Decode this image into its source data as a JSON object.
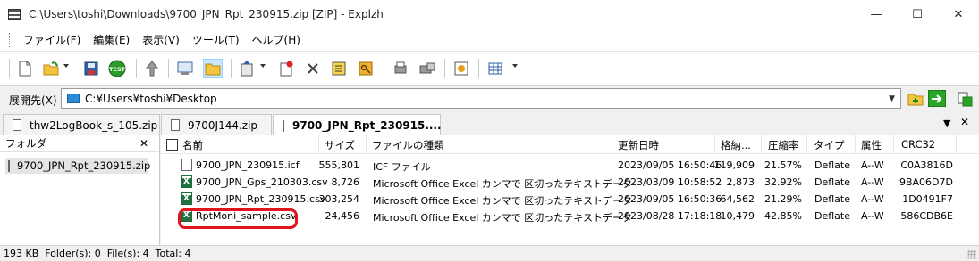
{
  "window": {
    "title": "C:\\Users\\toshi\\Downloads\\9700_JPN_Rpt_230915.zip [ZIP] - Explzh",
    "minimize": "—",
    "maximize": "☐",
    "close": "✕"
  },
  "menu": {
    "items": [
      "ファイル(F)",
      "編集(E)",
      "表示(V)",
      "ツール(T)",
      "ヘルプ(H)"
    ]
  },
  "toolbar": {
    "icons": [
      "new-archive-icon",
      "open-icon",
      "save-icon",
      "test-icon",
      "extract-icon",
      "view-icon",
      "open-folder-icon",
      "add-icon",
      "delete-marked-icon",
      "delete-icon",
      "properties-icon",
      "key-icon",
      "print-icon",
      "print-preview-icon",
      "info-icon",
      "view-mode-icon"
    ],
    "test_label": "TEST"
  },
  "address": {
    "label": "展開先(X)",
    "path": "C:¥Users¥toshi¥Desktop"
  },
  "tabs": [
    {
      "label": "thw2LogBook_s_105.zip"
    },
    {
      "label": "9700J144.zip"
    },
    {
      "label": "9700_JPN_Rpt_230915...."
    }
  ],
  "folder_pane": {
    "title": "フォルダ",
    "close": "✕",
    "item": "9700_JPN_Rpt_230915.zip"
  },
  "file_list": {
    "columns": [
      "名前",
      "サイズ",
      "ファイルの種類",
      "更新日時",
      "格納...",
      "圧縮率",
      "タイプ",
      "属性",
      "CRC32"
    ],
    "rows": [
      {
        "name": "9700_JPN_230915.icf",
        "size": "555,801",
        "type": "ICF ファイル",
        "date": "2023/09/05 16:50:46",
        "packed": "119,909",
        "ratio": "21.57%",
        "method": "Deflate",
        "attr": "A--W",
        "crc": "C0A3816D",
        "icon": "file-icon"
      },
      {
        "name": "9700_JPN_Gps_210303.csv",
        "size": "8,726",
        "type": "Microsoft Office Excel カンマで 区切ったテキストデータ",
        "date": "2023/03/09 10:58:52",
        "packed": "2,873",
        "ratio": "32.92%",
        "method": "Deflate",
        "attr": "A--W",
        "crc": "9BA06D7D",
        "icon": "excel-csv-icon"
      },
      {
        "name": "9700_JPN_Rpt_230915.csv",
        "size": "303,254",
        "type": "Microsoft Office Excel カンマで 区切ったテキストデータ",
        "date": "2023/09/05 16:50:36",
        "packed": "64,562",
        "ratio": "21.29%",
        "method": "Deflate",
        "attr": "A--W",
        "crc": "1D0491F7",
        "icon": "excel-csv-icon"
      },
      {
        "name": "RptMoni_sample.csv",
        "size": "24,456",
        "type": "Microsoft Office Excel カンマで 区切ったテキストデータ",
        "date": "2023/08/28 17:18:18",
        "packed": "10,479",
        "ratio": "42.85%",
        "method": "Deflate",
        "attr": "A--W",
        "crc": "586CDB6E",
        "icon": "excel-csv-icon"
      }
    ]
  },
  "status": {
    "text": "193 KB  Folder(s): 0  File(s): 4  Total: 4"
  },
  "colors": {
    "highlight": "#e3141b",
    "selection": "#cce8ff"
  }
}
